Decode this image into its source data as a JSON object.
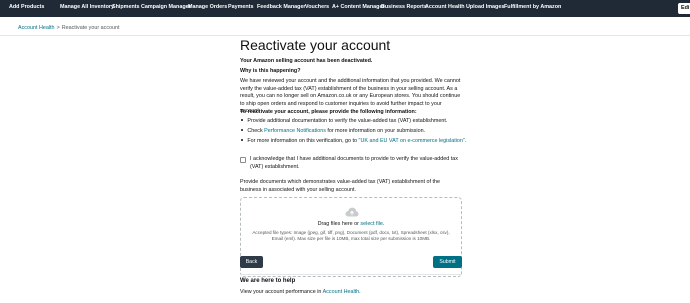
{
  "nav": {
    "items": [
      "Add Products",
      "Manage All Inventory",
      "Shipments",
      "Campaign Manager",
      "Manage Orders",
      "Payments",
      "Feedback Manager",
      "Vouchers",
      "A+ Content Manager",
      "Business Reports",
      "Account Health",
      "Upload Images",
      "Fulfillment by Amazon"
    ],
    "edit_label": "Edi"
  },
  "breadcrumb": {
    "parent": "Account Health",
    "separator": ">",
    "current": "Reactivate your account"
  },
  "page": {
    "title": "Reactivate your account",
    "subtitle": "Your Amazon selling account has been deactivated.",
    "why_heading": "Why is this happening?",
    "why_body": "We have reviewed your account and the additional information that you provided. We cannot verify the value-added tax (VAT) establishment of the business in your selling account. As a result, you can no longer sell on Amazon.co.uk or any European stores. You should continue to ship open orders and respond to customer inquiries to avoid further impact to your account.",
    "reactivate_heading": "To reactivate your account, please provide the following information:",
    "bullet1": "Provide additional documentation to verify the value-added tax (VAT) establishment.",
    "bullet2_prefix": "Check ",
    "bullet2_link": "Performance Notifications",
    "bullet2_suffix": " for more information on your submission.",
    "bullet3_prefix": "For more information on this verification, go to ",
    "bullet3_link": "\"UK and EU VAT on e-commerce legislation\"",
    "bullet3_suffix": ".",
    "acknowledge": "I acknowledge that I have additional documents to provide to verify the value-added tax (VAT) establishment.",
    "provide_docs": "Provide documents which demonstrates value-added tax (VAT) establishment of the business in associated with your selling account.",
    "drop_prefix": "Drag files here or ",
    "drop_link": "select file",
    "drop_suffix": ".",
    "accepted_types": "Accepted file types: Image (jpeg, gif, tiff, png), Document (pdf, docx, txt), Spreadsheet (xlsx, csv), Email (eml). Max size per file is 10MB, max total size per submission is 10MB.",
    "back_label": "Back",
    "submit_label": "Submit",
    "help_heading": "We are here to help",
    "help_prefix": "View your account performance in ",
    "help_link": "Account Health",
    "help_suffix": "."
  },
  "colors": {
    "nav_bg": "#1f2a36",
    "link": "#007185",
    "back_btn": "#2e3a47",
    "submit_btn": "#007185"
  }
}
